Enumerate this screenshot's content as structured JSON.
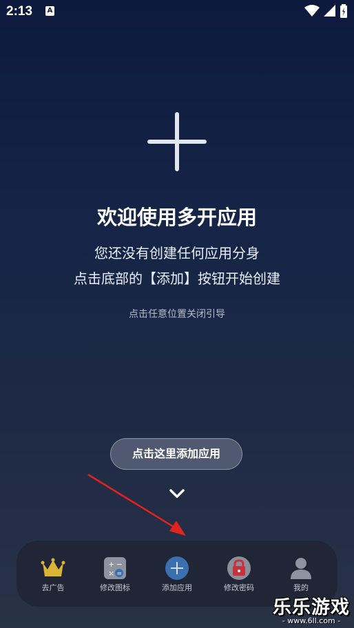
{
  "status_bar": {
    "time": "2:13",
    "notification_letter": "A"
  },
  "welcome": {
    "title": "欢迎使用多开应用",
    "line1": "您还没有创建任何应用分身",
    "line2": "点击底部的【添加】按钮开始创建",
    "hint": "点击任意位置关闭引导"
  },
  "guide": {
    "label": "点击这里添加应用"
  },
  "nav": {
    "items": [
      {
        "label": "去广告",
        "icon": "crown-icon"
      },
      {
        "label": "修改图标",
        "icon": "calculator-icon"
      },
      {
        "label": "添加应用",
        "icon": "add-circle-icon"
      },
      {
        "label": "修改密码",
        "icon": "lock-icon"
      },
      {
        "label": "我的",
        "icon": "person-icon"
      }
    ]
  },
  "watermark": {
    "title": "乐乐游戏",
    "url": "- www.6ll.com -"
  },
  "colors": {
    "accent_blue": "#3a6fb0",
    "lock_red": "#c8313c",
    "crown_gold": "#d9b436",
    "arrow_red": "#e0231f"
  }
}
